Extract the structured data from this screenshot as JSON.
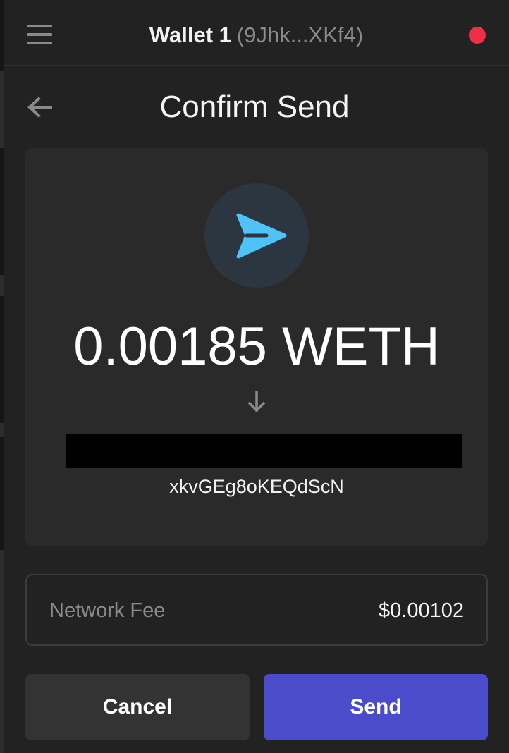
{
  "header": {
    "wallet_name": "Wallet 1",
    "wallet_address": "(9Jhk...XKf4)",
    "status_color": "#ef2f48",
    "menu_icon": "hamburger-menu-icon"
  },
  "page": {
    "title": "Confirm Send",
    "back_icon": "arrow-left-icon"
  },
  "transfer": {
    "icon": "send-icon",
    "icon_color": "#4fc3f7",
    "amount": "0.00185 WETH",
    "direction_icon": "arrow-down-icon",
    "recipient_suffix": "xkvGEg8oKEQdScN"
  },
  "fee": {
    "label": "Network Fee",
    "value": "$0.00102"
  },
  "actions": {
    "cancel_label": "Cancel",
    "send_label": "Send",
    "send_color": "#4a4ccc"
  }
}
